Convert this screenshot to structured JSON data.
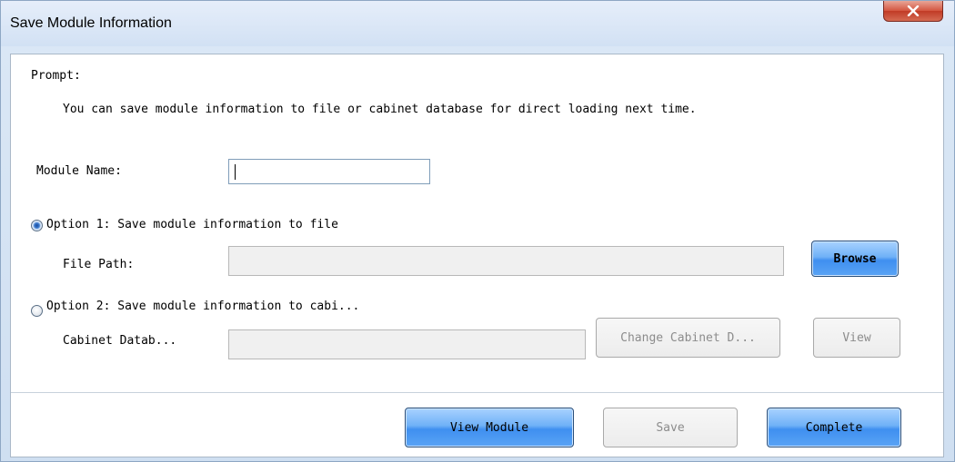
{
  "window": {
    "title": "Save Module Information",
    "close_icon": "close-icon"
  },
  "prompt": {
    "label": "Prompt:",
    "text": "You can save module information to file or cabinet database for direct loading next time."
  },
  "module_name": {
    "label": "Module Name:",
    "value": ""
  },
  "option1": {
    "label": "Option 1: Save module information to file",
    "selected": true,
    "file_path_label": "File Path:",
    "file_path_value": "",
    "browse_label": "Browse"
  },
  "option2": {
    "label": "Option 2: Save module information to cabi...",
    "selected": false,
    "cabinet_label": "Cabinet Datab...",
    "cabinet_value": "",
    "change_label": "Change Cabinet D...",
    "view_label": "View"
  },
  "footer": {
    "view_module_label": "View Module",
    "save_label": "Save",
    "complete_label": "Complete"
  },
  "colors": {
    "accent_button": "#5aa4f5",
    "close_button": "#d4553f",
    "window_frame": "#d2e1f4"
  }
}
